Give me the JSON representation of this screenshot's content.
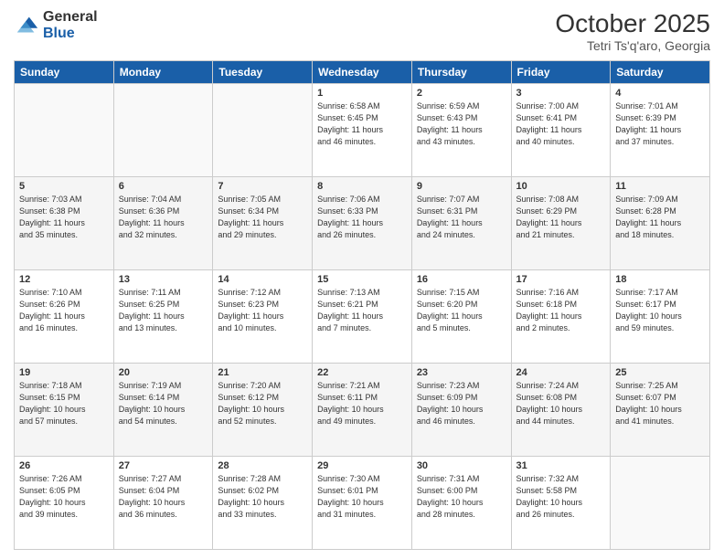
{
  "header": {
    "logo_general": "General",
    "logo_blue": "Blue",
    "month_title": "October 2025",
    "subtitle": "Tetri Ts'q'aro, Georgia"
  },
  "weekdays": [
    "Sunday",
    "Monday",
    "Tuesday",
    "Wednesday",
    "Thursday",
    "Friday",
    "Saturday"
  ],
  "rows": [
    {
      "cells": [
        {
          "empty": true
        },
        {
          "empty": true
        },
        {
          "empty": true
        },
        {
          "day": 1,
          "info": "Sunrise: 6:58 AM\nSunset: 6:45 PM\nDaylight: 11 hours\nand 46 minutes."
        },
        {
          "day": 2,
          "info": "Sunrise: 6:59 AM\nSunset: 6:43 PM\nDaylight: 11 hours\nand 43 minutes."
        },
        {
          "day": 3,
          "info": "Sunrise: 7:00 AM\nSunset: 6:41 PM\nDaylight: 11 hours\nand 40 minutes."
        },
        {
          "day": 4,
          "info": "Sunrise: 7:01 AM\nSunset: 6:39 PM\nDaylight: 11 hours\nand 37 minutes."
        }
      ]
    },
    {
      "cells": [
        {
          "day": 5,
          "info": "Sunrise: 7:03 AM\nSunset: 6:38 PM\nDaylight: 11 hours\nand 35 minutes."
        },
        {
          "day": 6,
          "info": "Sunrise: 7:04 AM\nSunset: 6:36 PM\nDaylight: 11 hours\nand 32 minutes."
        },
        {
          "day": 7,
          "info": "Sunrise: 7:05 AM\nSunset: 6:34 PM\nDaylight: 11 hours\nand 29 minutes."
        },
        {
          "day": 8,
          "info": "Sunrise: 7:06 AM\nSunset: 6:33 PM\nDaylight: 11 hours\nand 26 minutes."
        },
        {
          "day": 9,
          "info": "Sunrise: 7:07 AM\nSunset: 6:31 PM\nDaylight: 11 hours\nand 24 minutes."
        },
        {
          "day": 10,
          "info": "Sunrise: 7:08 AM\nSunset: 6:29 PM\nDaylight: 11 hours\nand 21 minutes."
        },
        {
          "day": 11,
          "info": "Sunrise: 7:09 AM\nSunset: 6:28 PM\nDaylight: 11 hours\nand 18 minutes."
        }
      ]
    },
    {
      "cells": [
        {
          "day": 12,
          "info": "Sunrise: 7:10 AM\nSunset: 6:26 PM\nDaylight: 11 hours\nand 16 minutes."
        },
        {
          "day": 13,
          "info": "Sunrise: 7:11 AM\nSunset: 6:25 PM\nDaylight: 11 hours\nand 13 minutes."
        },
        {
          "day": 14,
          "info": "Sunrise: 7:12 AM\nSunset: 6:23 PM\nDaylight: 11 hours\nand 10 minutes."
        },
        {
          "day": 15,
          "info": "Sunrise: 7:13 AM\nSunset: 6:21 PM\nDaylight: 11 hours\nand 7 minutes."
        },
        {
          "day": 16,
          "info": "Sunrise: 7:15 AM\nSunset: 6:20 PM\nDaylight: 11 hours\nand 5 minutes."
        },
        {
          "day": 17,
          "info": "Sunrise: 7:16 AM\nSunset: 6:18 PM\nDaylight: 11 hours\nand 2 minutes."
        },
        {
          "day": 18,
          "info": "Sunrise: 7:17 AM\nSunset: 6:17 PM\nDaylight: 10 hours\nand 59 minutes."
        }
      ]
    },
    {
      "cells": [
        {
          "day": 19,
          "info": "Sunrise: 7:18 AM\nSunset: 6:15 PM\nDaylight: 10 hours\nand 57 minutes."
        },
        {
          "day": 20,
          "info": "Sunrise: 7:19 AM\nSunset: 6:14 PM\nDaylight: 10 hours\nand 54 minutes."
        },
        {
          "day": 21,
          "info": "Sunrise: 7:20 AM\nSunset: 6:12 PM\nDaylight: 10 hours\nand 52 minutes."
        },
        {
          "day": 22,
          "info": "Sunrise: 7:21 AM\nSunset: 6:11 PM\nDaylight: 10 hours\nand 49 minutes."
        },
        {
          "day": 23,
          "info": "Sunrise: 7:23 AM\nSunset: 6:09 PM\nDaylight: 10 hours\nand 46 minutes."
        },
        {
          "day": 24,
          "info": "Sunrise: 7:24 AM\nSunset: 6:08 PM\nDaylight: 10 hours\nand 44 minutes."
        },
        {
          "day": 25,
          "info": "Sunrise: 7:25 AM\nSunset: 6:07 PM\nDaylight: 10 hours\nand 41 minutes."
        }
      ]
    },
    {
      "cells": [
        {
          "day": 26,
          "info": "Sunrise: 7:26 AM\nSunset: 6:05 PM\nDaylight: 10 hours\nand 39 minutes."
        },
        {
          "day": 27,
          "info": "Sunrise: 7:27 AM\nSunset: 6:04 PM\nDaylight: 10 hours\nand 36 minutes."
        },
        {
          "day": 28,
          "info": "Sunrise: 7:28 AM\nSunset: 6:02 PM\nDaylight: 10 hours\nand 33 minutes."
        },
        {
          "day": 29,
          "info": "Sunrise: 7:30 AM\nSunset: 6:01 PM\nDaylight: 10 hours\nand 31 minutes."
        },
        {
          "day": 30,
          "info": "Sunrise: 7:31 AM\nSunset: 6:00 PM\nDaylight: 10 hours\nand 28 minutes."
        },
        {
          "day": 31,
          "info": "Sunrise: 7:32 AM\nSunset: 5:58 PM\nDaylight: 10 hours\nand 26 minutes."
        },
        {
          "empty": true
        }
      ]
    }
  ]
}
